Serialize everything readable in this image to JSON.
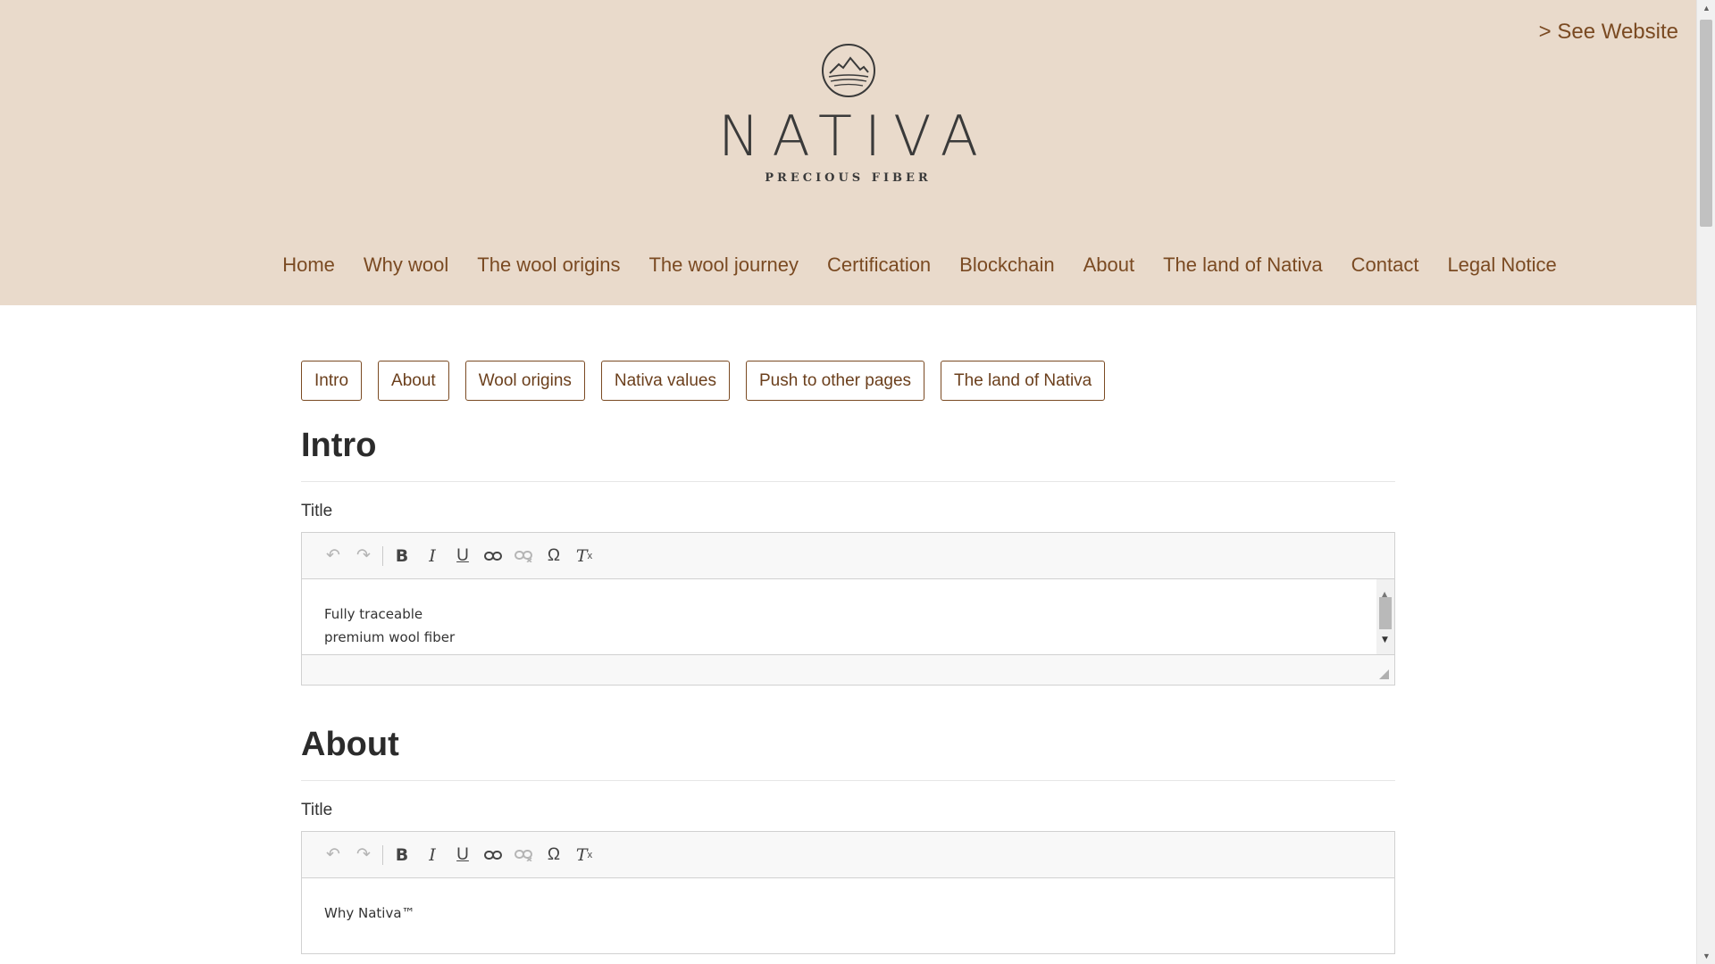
{
  "header": {
    "see_website": "> See Website",
    "brand_name": "NATIVA",
    "brand_tagline": "PRECIOUS FIBER",
    "nav": [
      "Home",
      "Why wool",
      "The wool origins",
      "The wool journey",
      "Certification",
      "Blockchain",
      "About",
      "The land of Nativa",
      "Contact",
      "Legal Notice"
    ]
  },
  "tabs": [
    "Intro",
    "About",
    "Wool origins",
    "Nativa values",
    "Push to other pages",
    "The land of Nativa"
  ],
  "sections": [
    {
      "title": "Intro",
      "field_label": "Title",
      "content_lines": [
        "Fully traceable",
        "premium wool fiber"
      ]
    },
    {
      "title": "About",
      "field_label": "Title",
      "content_lines": [
        "Why Nativa™"
      ]
    }
  ],
  "toolbar": {
    "icons": [
      "undo-icon",
      "redo-icon",
      "bold-icon",
      "italic-icon",
      "underline-icon",
      "link-icon",
      "unlink-icon",
      "special-character-icon",
      "remove-format-icon"
    ]
  },
  "colors": {
    "header_bg": "#e9dacb",
    "accent": "#7a4a22"
  }
}
